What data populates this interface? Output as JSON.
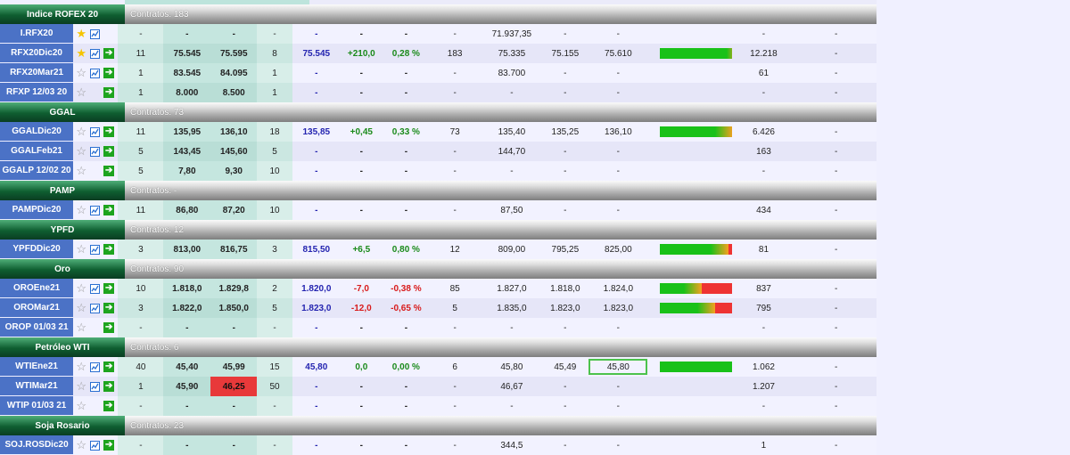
{
  "colors": {
    "symbol_bg": "#4b72c6",
    "group_header": "#0f5e31",
    "positive": "#1a8a1a",
    "negative": "#d81b1b",
    "last_price": "#2424b0",
    "star_active": "#f5c400",
    "arrow_icon": "#1ea41e"
  },
  "groups": [
    {
      "name": "Indice ROFEX 20",
      "contracts": "Contratos: 183",
      "rows": [
        {
          "symbol": "I.RFX20",
          "fav": true,
          "chart": true,
          "arrow": false,
          "bid_qty": "-",
          "bid": "-",
          "ask": "-",
          "ask_qty": "-",
          "last": "-",
          "var": "-",
          "pct": "-",
          "vol": "-",
          "p1": "71.937,35",
          "p2": "-",
          "p3": "-",
          "range": null,
          "amount": "-",
          "tail": "-"
        },
        {
          "symbol": "RFX20Dic20",
          "fav": true,
          "chart": true,
          "arrow": true,
          "bid_qty": "11",
          "bid": "75.545",
          "ask": "75.595",
          "ask_qty": "8",
          "last": "75.545",
          "var": "+210,0",
          "pct": "0,28 %",
          "vol": "183",
          "p1": "75.335",
          "p2": "75.155",
          "p3": "75.610",
          "range": 0.88,
          "amount": "12.218",
          "tail": "-"
        },
        {
          "symbol": "RFX20Mar21",
          "fav": false,
          "chart": true,
          "arrow": true,
          "bid_qty": "1",
          "bid": "83.545",
          "ask": "84.095",
          "ask_qty": "1",
          "last": "-",
          "var": "-",
          "pct": "-",
          "vol": "-",
          "p1": "83.700",
          "p2": "-",
          "p3": "-",
          "range": null,
          "amount": "61",
          "tail": "-"
        },
        {
          "symbol": "RFXP 12/03 20",
          "fav": false,
          "chart": false,
          "arrow": true,
          "bid_qty": "1",
          "bid": "8.000",
          "ask": "8.500",
          "ask_qty": "1",
          "last": "-",
          "var": "-",
          "pct": "-",
          "vol": "-",
          "p1": "-",
          "p2": "-",
          "p3": "-",
          "range": null,
          "amount": "-",
          "tail": "-"
        }
      ]
    },
    {
      "name": "GGAL",
      "contracts": "Contratos: 73",
      "rows": [
        {
          "symbol": "GGALDic20",
          "fav": false,
          "chart": true,
          "arrow": true,
          "bid_qty": "11",
          "bid": "135,95",
          "ask": "136,10",
          "ask_qty": "18",
          "last": "135,85",
          "var": "+0,45",
          "pct": "0,33 %",
          "vol": "73",
          "p1": "135,40",
          "p2": "135,25",
          "p3": "136,10",
          "range": 0.73,
          "amount": "6.426",
          "tail": "-"
        },
        {
          "symbol": "GGALFeb21",
          "fav": false,
          "chart": true,
          "arrow": true,
          "bid_qty": "5",
          "bid": "143,45",
          "ask": "145,60",
          "ask_qty": "5",
          "last": "-",
          "var": "-",
          "pct": "-",
          "vol": "-",
          "p1": "144,70",
          "p2": "-",
          "p3": "-",
          "range": null,
          "amount": "163",
          "tail": "-"
        },
        {
          "symbol": "GGALP 12/02 20",
          "fav": false,
          "chart": false,
          "arrow": true,
          "bid_qty": "5",
          "bid": "7,80",
          "ask": "9,30",
          "ask_qty": "10",
          "last": "-",
          "var": "-",
          "pct": "-",
          "vol": "-",
          "p1": "-",
          "p2": "-",
          "p3": "-",
          "range": null,
          "amount": "-",
          "tail": "-"
        }
      ]
    },
    {
      "name": "PAMP",
      "contracts": "Contratos: -",
      "rows": [
        {
          "symbol": "PAMPDic20",
          "fav": false,
          "chart": true,
          "arrow": true,
          "bid_qty": "11",
          "bid": "86,80",
          "ask": "87,20",
          "ask_qty": "10",
          "last": "-",
          "var": "-",
          "pct": "-",
          "vol": "-",
          "p1": "87,50",
          "p2": "-",
          "p3": "-",
          "range": null,
          "amount": "434",
          "tail": "-"
        }
      ]
    },
    {
      "name": "YPFD",
      "contracts": "Contratos: 12",
      "rows": [
        {
          "symbol": "YPFDDic20",
          "fav": false,
          "chart": true,
          "arrow": true,
          "bid_qty": "3",
          "bid": "813,00",
          "ask": "816,75",
          "ask_qty": "3",
          "last": "815,50",
          "var": "+6,5",
          "pct": "0,80 %",
          "vol": "12",
          "p1": "809,00",
          "p2": "795,25",
          "p3": "825,00",
          "range": 0.68,
          "amount": "81",
          "tail": "-"
        }
      ]
    },
    {
      "name": "Oro",
      "contracts": "Contratos: 90",
      "rows": [
        {
          "symbol": "OROEne21",
          "fav": false,
          "chart": true,
          "arrow": true,
          "bid_qty": "10",
          "bid": "1.818,0",
          "ask": "1.829,8",
          "ask_qty": "2",
          "last": "1.820,0",
          "var": "-7,0",
          "pct": "-0,38 %",
          "vol": "85",
          "p1": "1.827,0",
          "p2": "1.818,0",
          "p3": "1.824,0",
          "range": 0.33,
          "amount": "837",
          "tail": "-"
        },
        {
          "symbol": "OROMar21",
          "fav": false,
          "chart": true,
          "arrow": true,
          "bid_qty": "3",
          "bid": "1.822,0",
          "ask": "1.850,0",
          "ask_qty": "5",
          "last": "1.823,0",
          "var": "-12,0",
          "pct": "-0,65 %",
          "vol": "5",
          "p1": "1.835,0",
          "p2": "1.823,0",
          "p3": "1.823,0",
          "range": 0.5,
          "amount": "795",
          "tail": "-"
        },
        {
          "symbol": "OROP 01/03 21",
          "fav": false,
          "chart": false,
          "arrow": true,
          "bid_qty": "-",
          "bid": "-",
          "ask": "-",
          "ask_qty": "-",
          "last": "-",
          "var": "-",
          "pct": "-",
          "vol": "-",
          "p1": "-",
          "p2": "-",
          "p3": "-",
          "range": null,
          "amount": "-",
          "tail": "-"
        }
      ]
    },
    {
      "name": "Petróleo WTI",
      "contracts": "Contratos: 6",
      "rows": [
        {
          "symbol": "WTIEne21",
          "fav": false,
          "chart": true,
          "arrow": true,
          "bid_qty": "40",
          "bid": "45,40",
          "ask": "45,99",
          "ask_qty": "15",
          "last": "45,80",
          "var": "0,0",
          "pct": "0,00 %",
          "vol": "6",
          "p1": "45,80",
          "p2": "45,49",
          "p3": "45,80",
          "p3_boxed": true,
          "range": 1.0,
          "amount": "1.062",
          "tail": "-"
        },
        {
          "symbol": "WTIMar21",
          "fav": false,
          "chart": true,
          "arrow": true,
          "bid_qty": "1",
          "bid": "45,90",
          "ask": "46,25",
          "ask_highlight": true,
          "ask_qty": "50",
          "last": "-",
          "var": "-",
          "pct": "-",
          "vol": "-",
          "p1": "46,67",
          "p2": "-",
          "p3": "-",
          "range": null,
          "amount": "1.207",
          "tail": "-"
        },
        {
          "symbol": "WTIP 01/03 21",
          "fav": false,
          "chart": false,
          "arrow": true,
          "bid_qty": "-",
          "bid": "-",
          "ask": "-",
          "ask_qty": "-",
          "last": "-",
          "var": "-",
          "pct": "-",
          "vol": "-",
          "p1": "-",
          "p2": "-",
          "p3": "-",
          "range": null,
          "amount": "-",
          "tail": "-"
        }
      ]
    },
    {
      "name": "Soja Rosario",
      "contracts": "Contratos: 23",
      "rows": [
        {
          "symbol": "SOJ.ROSDic20",
          "fav": false,
          "chart": true,
          "arrow": true,
          "bid_qty": "-",
          "bid": "-",
          "ask": "-",
          "ask_qty": "-",
          "last": "-",
          "var": "-",
          "pct": "-",
          "vol": "-",
          "p1": "344,5",
          "p2": "-",
          "p3": "-",
          "range": null,
          "amount": "1",
          "tail": "-"
        }
      ]
    }
  ]
}
